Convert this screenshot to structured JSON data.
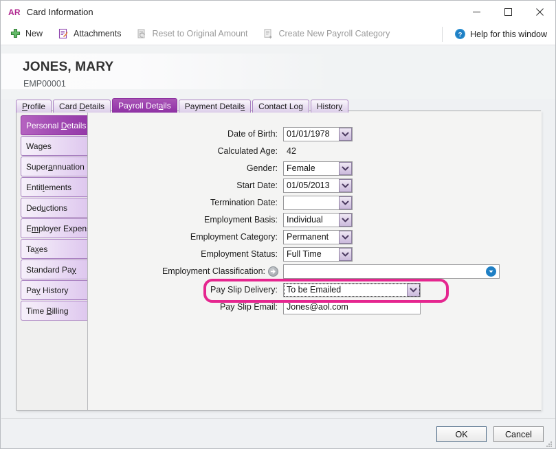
{
  "window": {
    "app_badge": "AR",
    "title": "Card Information",
    "minimize_icon": "minimize-icon",
    "maximize_icon": "maximize-icon",
    "close_icon": "close-icon"
  },
  "toolbar": {
    "items": [
      {
        "label": "New",
        "icon": "plus-icon",
        "enabled": true
      },
      {
        "label": "Attachments",
        "icon": "attachment-document-icon",
        "enabled": true
      },
      {
        "label": "Reset to Original Amount",
        "icon": "reset-icon",
        "enabled": false
      },
      {
        "label": "Create New Payroll Category",
        "icon": "new-document-icon",
        "enabled": false
      }
    ],
    "help": {
      "label": "Help for this window",
      "icon": "help-question-icon"
    }
  },
  "header": {
    "employee_name": "JONES, MARY",
    "employee_id": "EMP00001"
  },
  "tabs": [
    {
      "label": "Profile",
      "accel": "P",
      "active": false
    },
    {
      "label": "Card Details",
      "accel": "D",
      "active": false
    },
    {
      "label": "Payroll Details",
      "accel": "a",
      "active": true
    },
    {
      "label": "Payment Details",
      "accel": "s",
      "active": false
    },
    {
      "label": "Contact Log",
      "accel": "g",
      "active": false
    },
    {
      "label": "History",
      "accel": "y",
      "active": false
    }
  ],
  "sidebar": {
    "items": [
      {
        "label": "Personal Details",
        "active": true
      },
      {
        "label": "Wages",
        "active": false
      },
      {
        "label": "Superannuation",
        "active": false
      },
      {
        "label": "Entitlements",
        "active": false
      },
      {
        "label": "Deductions",
        "active": false
      },
      {
        "label": "Employer Expenses",
        "active": false
      },
      {
        "label": "Taxes",
        "active": false
      },
      {
        "label": "Standard Pay",
        "active": false
      },
      {
        "label": "Pay History",
        "active": false
      },
      {
        "label": "Time Billing",
        "active": false
      }
    ]
  },
  "form": {
    "date_of_birth": {
      "label": "Date of Birth:",
      "value": "01/01/1978"
    },
    "calculated_age": {
      "label": "Calculated Age:",
      "value": "42"
    },
    "gender": {
      "label": "Gender:",
      "value": "Female"
    },
    "start_date": {
      "label": "Start Date:",
      "value": "01/05/2013"
    },
    "termination_date": {
      "label": "Termination Date:",
      "value": ""
    },
    "employment_basis": {
      "label": "Employment Basis:",
      "value": "Individual"
    },
    "employment_category": {
      "label": "Employment Category:",
      "value": "Permanent"
    },
    "employment_status": {
      "label": "Employment Status:",
      "value": "Full Time"
    },
    "employment_classification": {
      "label": "Employment Classification:",
      "value": ""
    },
    "pay_slip_delivery": {
      "label": "Pay Slip Delivery:",
      "value": "To be Emailed"
    },
    "pay_slip_email": {
      "label": "Pay Slip Email:",
      "value": "Jones@aol.com"
    }
  },
  "footer": {
    "ok_label": "OK",
    "cancel_label": "Cancel"
  },
  "colors": {
    "accent_purple": "#9437a8",
    "highlight_pink": "#e5268f",
    "brand_magenta": "#b0268f",
    "help_blue": "#1f7fc4"
  }
}
